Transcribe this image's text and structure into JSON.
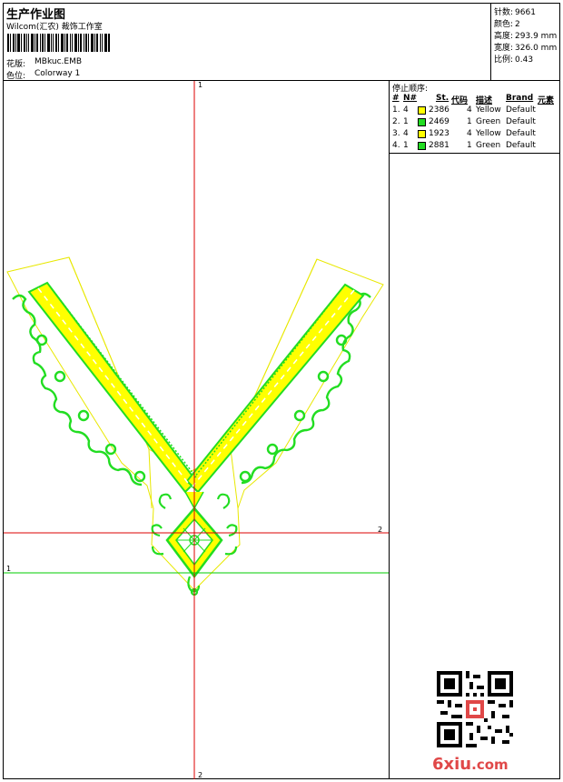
{
  "header": {
    "title": "生产作业图",
    "company": "Wilcom(汇农) 裁饰工作室"
  },
  "design": {
    "pattern_label": "花版:",
    "pattern_value": "MBkuc.EMB",
    "colorway_label": "色位:",
    "colorway_value": "Colorway 1"
  },
  "stats": [
    {
      "label": "针数:",
      "value": "9661"
    },
    {
      "label": "颜色:",
      "value": "2"
    },
    {
      "label": "高度:",
      "value": "293.9 mm"
    },
    {
      "label": "宽度:",
      "value": "326.0 mm"
    },
    {
      "label": "比例:",
      "value": "0.43"
    }
  ],
  "stop_sequence": {
    "title": "停止顺序:",
    "headers": [
      "#",
      "N#",
      "St.",
      "代码",
      "描述",
      "Brand",
      "元素"
    ],
    "rows": [
      {
        "index": "1.",
        "needle": "4",
        "color": "#ffff00",
        "stitches": "2386",
        "code": "4",
        "description": "Yellow",
        "brand": "Default"
      },
      {
        "index": "2.",
        "needle": "1",
        "color": "#22dd22",
        "stitches": "2469",
        "code": "1",
        "description": "Green",
        "brand": "Default"
      },
      {
        "index": "3.",
        "needle": "4",
        "color": "#ffff00",
        "stitches": "1923",
        "code": "4",
        "description": "Yellow",
        "brand": "Default"
      },
      {
        "index": "4.",
        "needle": "1",
        "color": "#22dd22",
        "stitches": "2881",
        "code": "1",
        "description": "Green",
        "brand": "Default"
      }
    ]
  },
  "axes": {
    "vertical_top_label": "1",
    "vertical_bottom_label": "2",
    "horizontal_red_label": "2",
    "horizontal_green_label": "1"
  },
  "watermark": {
    "text": "6xiu",
    "suffix": ".com"
  },
  "colors": {
    "yellow": "#ffff00",
    "green": "#22dd22",
    "outline_yellow": "#e8e800",
    "axis_red": "#dd0000",
    "axis_green": "#00cc00",
    "watermark": "#e04848"
  }
}
